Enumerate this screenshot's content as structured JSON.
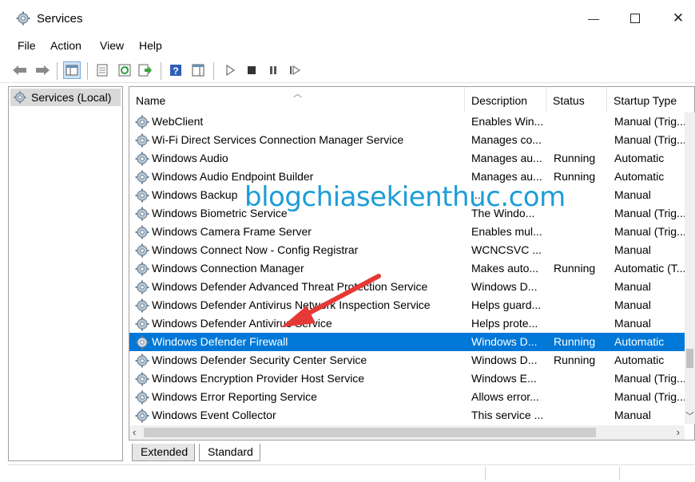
{
  "window": {
    "title": "Services",
    "minimize": "—",
    "close": "✕"
  },
  "menu": [
    "File",
    "Action",
    "View",
    "Help"
  ],
  "toolbar_icons": [
    "back-icon",
    "forward-icon",
    "show-hide-tree-icon",
    "properties-icon",
    "refresh-icon",
    "export-list-icon",
    "help-icon",
    "show-hide-action-pane-icon",
    "start-service-icon",
    "stop-service-icon",
    "pause-service-icon",
    "restart-service-icon"
  ],
  "tree": {
    "label": "Services (Local)"
  },
  "columns": {
    "name": "Name",
    "description": "Description",
    "status": "Status",
    "startup": "Startup Type"
  },
  "services": [
    {
      "name": "WebClient",
      "description": "Enables Win...",
      "status": "",
      "startup": "Manual (Trig..."
    },
    {
      "name": "Wi-Fi Direct Services Connection Manager Service",
      "description": "Manages co...",
      "status": "",
      "startup": "Manual (Trig..."
    },
    {
      "name": "Windows Audio",
      "description": "Manages au...",
      "status": "Running",
      "startup": "Automatic"
    },
    {
      "name": "Windows Audio Endpoint Builder",
      "description": "Manages au...",
      "status": "Running",
      "startup": "Automatic"
    },
    {
      "name": "Windows Backup",
      "description": "...",
      "status": "",
      "startup": "Manual"
    },
    {
      "name": "Windows Biometric Service",
      "description": "The Windo...",
      "status": "",
      "startup": "Manual (Trig..."
    },
    {
      "name": "Windows Camera Frame Server",
      "description": "Enables mul...",
      "status": "",
      "startup": "Manual (Trig..."
    },
    {
      "name": "Windows Connect Now - Config Registrar",
      "description": "WCNCSVC ...",
      "status": "",
      "startup": "Manual"
    },
    {
      "name": "Windows Connection Manager",
      "description": "Makes auto...",
      "status": "Running",
      "startup": "Automatic (T..."
    },
    {
      "name": "Windows Defender Advanced Threat Protection Service",
      "description": "Windows D...",
      "status": "",
      "startup": "Manual"
    },
    {
      "name": "Windows Defender Antivirus Network Inspection Service",
      "description": "Helps guard...",
      "status": "",
      "startup": "Manual"
    },
    {
      "name": "Windows Defender Antivirus Service",
      "description": "Helps prote...",
      "status": "",
      "startup": "Manual"
    },
    {
      "name": "Windows Defender Firewall",
      "description": "Windows D...",
      "status": "Running",
      "startup": "Automatic",
      "selected": true
    },
    {
      "name": "Windows Defender Security Center Service",
      "description": "Windows D...",
      "status": "Running",
      "startup": "Automatic"
    },
    {
      "name": "Windows Encryption Provider Host Service",
      "description": "Windows E...",
      "status": "",
      "startup": "Manual (Trig..."
    },
    {
      "name": "Windows Error Reporting Service",
      "description": "Allows error...",
      "status": "",
      "startup": "Manual (Trig..."
    },
    {
      "name": "Windows Event Collector",
      "description": "This service ...",
      "status": "",
      "startup": "Manual"
    }
  ],
  "tabs": {
    "extended": "Extended",
    "standard": "Standard"
  },
  "watermark": "blogchiasekienthuc.com",
  "colors": {
    "selection": "#0078d7",
    "watermark": "#1d9dd8",
    "annotation_arrow": "#e53935"
  }
}
